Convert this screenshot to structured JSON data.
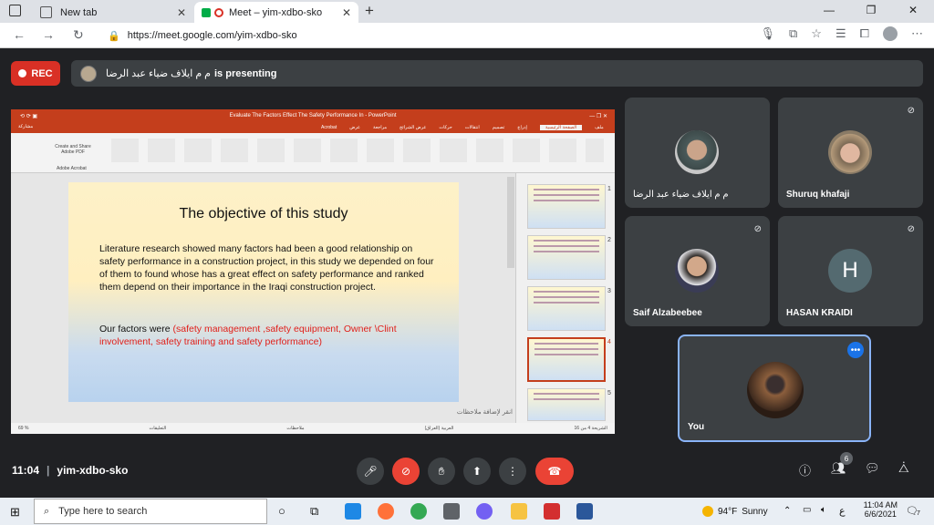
{
  "browser": {
    "tabs": [
      {
        "title": "New tab",
        "active": false
      },
      {
        "title": "Meet – yim-xdbo-sko",
        "active": true
      }
    ],
    "new_tab": "+",
    "url": "https://meet.google.com/yim-xdbo-sko",
    "window_controls": {
      "minimize": "—",
      "maximize": "❐",
      "close": "✕"
    },
    "icons": [
      "mic-icon",
      "camera-icon",
      "star-icon",
      "reading-list-icon",
      "collections-icon",
      "profile-icon",
      "menu-icon"
    ]
  },
  "meet": {
    "rec_label": "REC",
    "presenter_name": "م م ايلاف ضياء عبد الرضا",
    "presenting_label": "is presenting",
    "meeting_time": "11:04",
    "meeting_code": "yim-xdbo-sko",
    "participants_count": "6",
    "tiles": [
      {
        "name": "م م ايلاف ضياء عبد الرضا",
        "muted": false
      },
      {
        "name": "Shuruq khafaji",
        "muted": true
      },
      {
        "name": "Saif Alzabeebee",
        "muted": true
      },
      {
        "name": "HASAN KRAIDI",
        "initial": "H",
        "muted": true
      },
      {
        "name": "You",
        "muted": false
      }
    ]
  },
  "powerpoint": {
    "window_title": "Evaluate The Factors Effect The Safety Performance In - PowerPoint",
    "tabs": [
      "ملف",
      "الصفحة الرئيسية",
      "إدراج",
      "تصميم",
      "انتقالات",
      "حركات",
      "عرض الشرائح",
      "مراجعة",
      "عرض",
      "Acrobat"
    ],
    "selected_tab": "الصفحة الرئيسية",
    "share": "مشاركة",
    "acrobat_button": "Create and Share Adobe PDF",
    "acrobat_group": "Adobe Acrobat",
    "notes_placeholder": "انقر لإضافة ملاحظات",
    "zoom": "69 %",
    "slide_status": "الشريحة 4 من 16",
    "language": "العربية (العراق)",
    "notes_label": "ملاحظات",
    "comments_label": "التعليقات",
    "thumb_numbers": [
      "1",
      "2",
      "3",
      "4",
      "5"
    ]
  },
  "slide": {
    "title": "The objective of this study",
    "paragraph": "Literature research showed many factors had been a good relationship on safety performance in a construction project, in this study we depended on four of them to found whose has a great effect on safety performance and ranked them depend on their importance in the Iraqi construction project.",
    "factors_label": "Our factors were ",
    "factors": "(safety management ,safety equipment, Owner \\Clint involvement, safety training and safety performance)"
  },
  "taskbar": {
    "search_placeholder": "Type here to search",
    "weather_temp": "94°F",
    "weather_text": "Sunny",
    "lang": "ع",
    "time": "11:04 AM",
    "date": "6/6/2021",
    "notifications": "7"
  },
  "colors": {
    "rec": "#d93025",
    "end_call": "#ea4335",
    "highlight": "#8ab4f8",
    "ppt": "#c43e1c"
  }
}
